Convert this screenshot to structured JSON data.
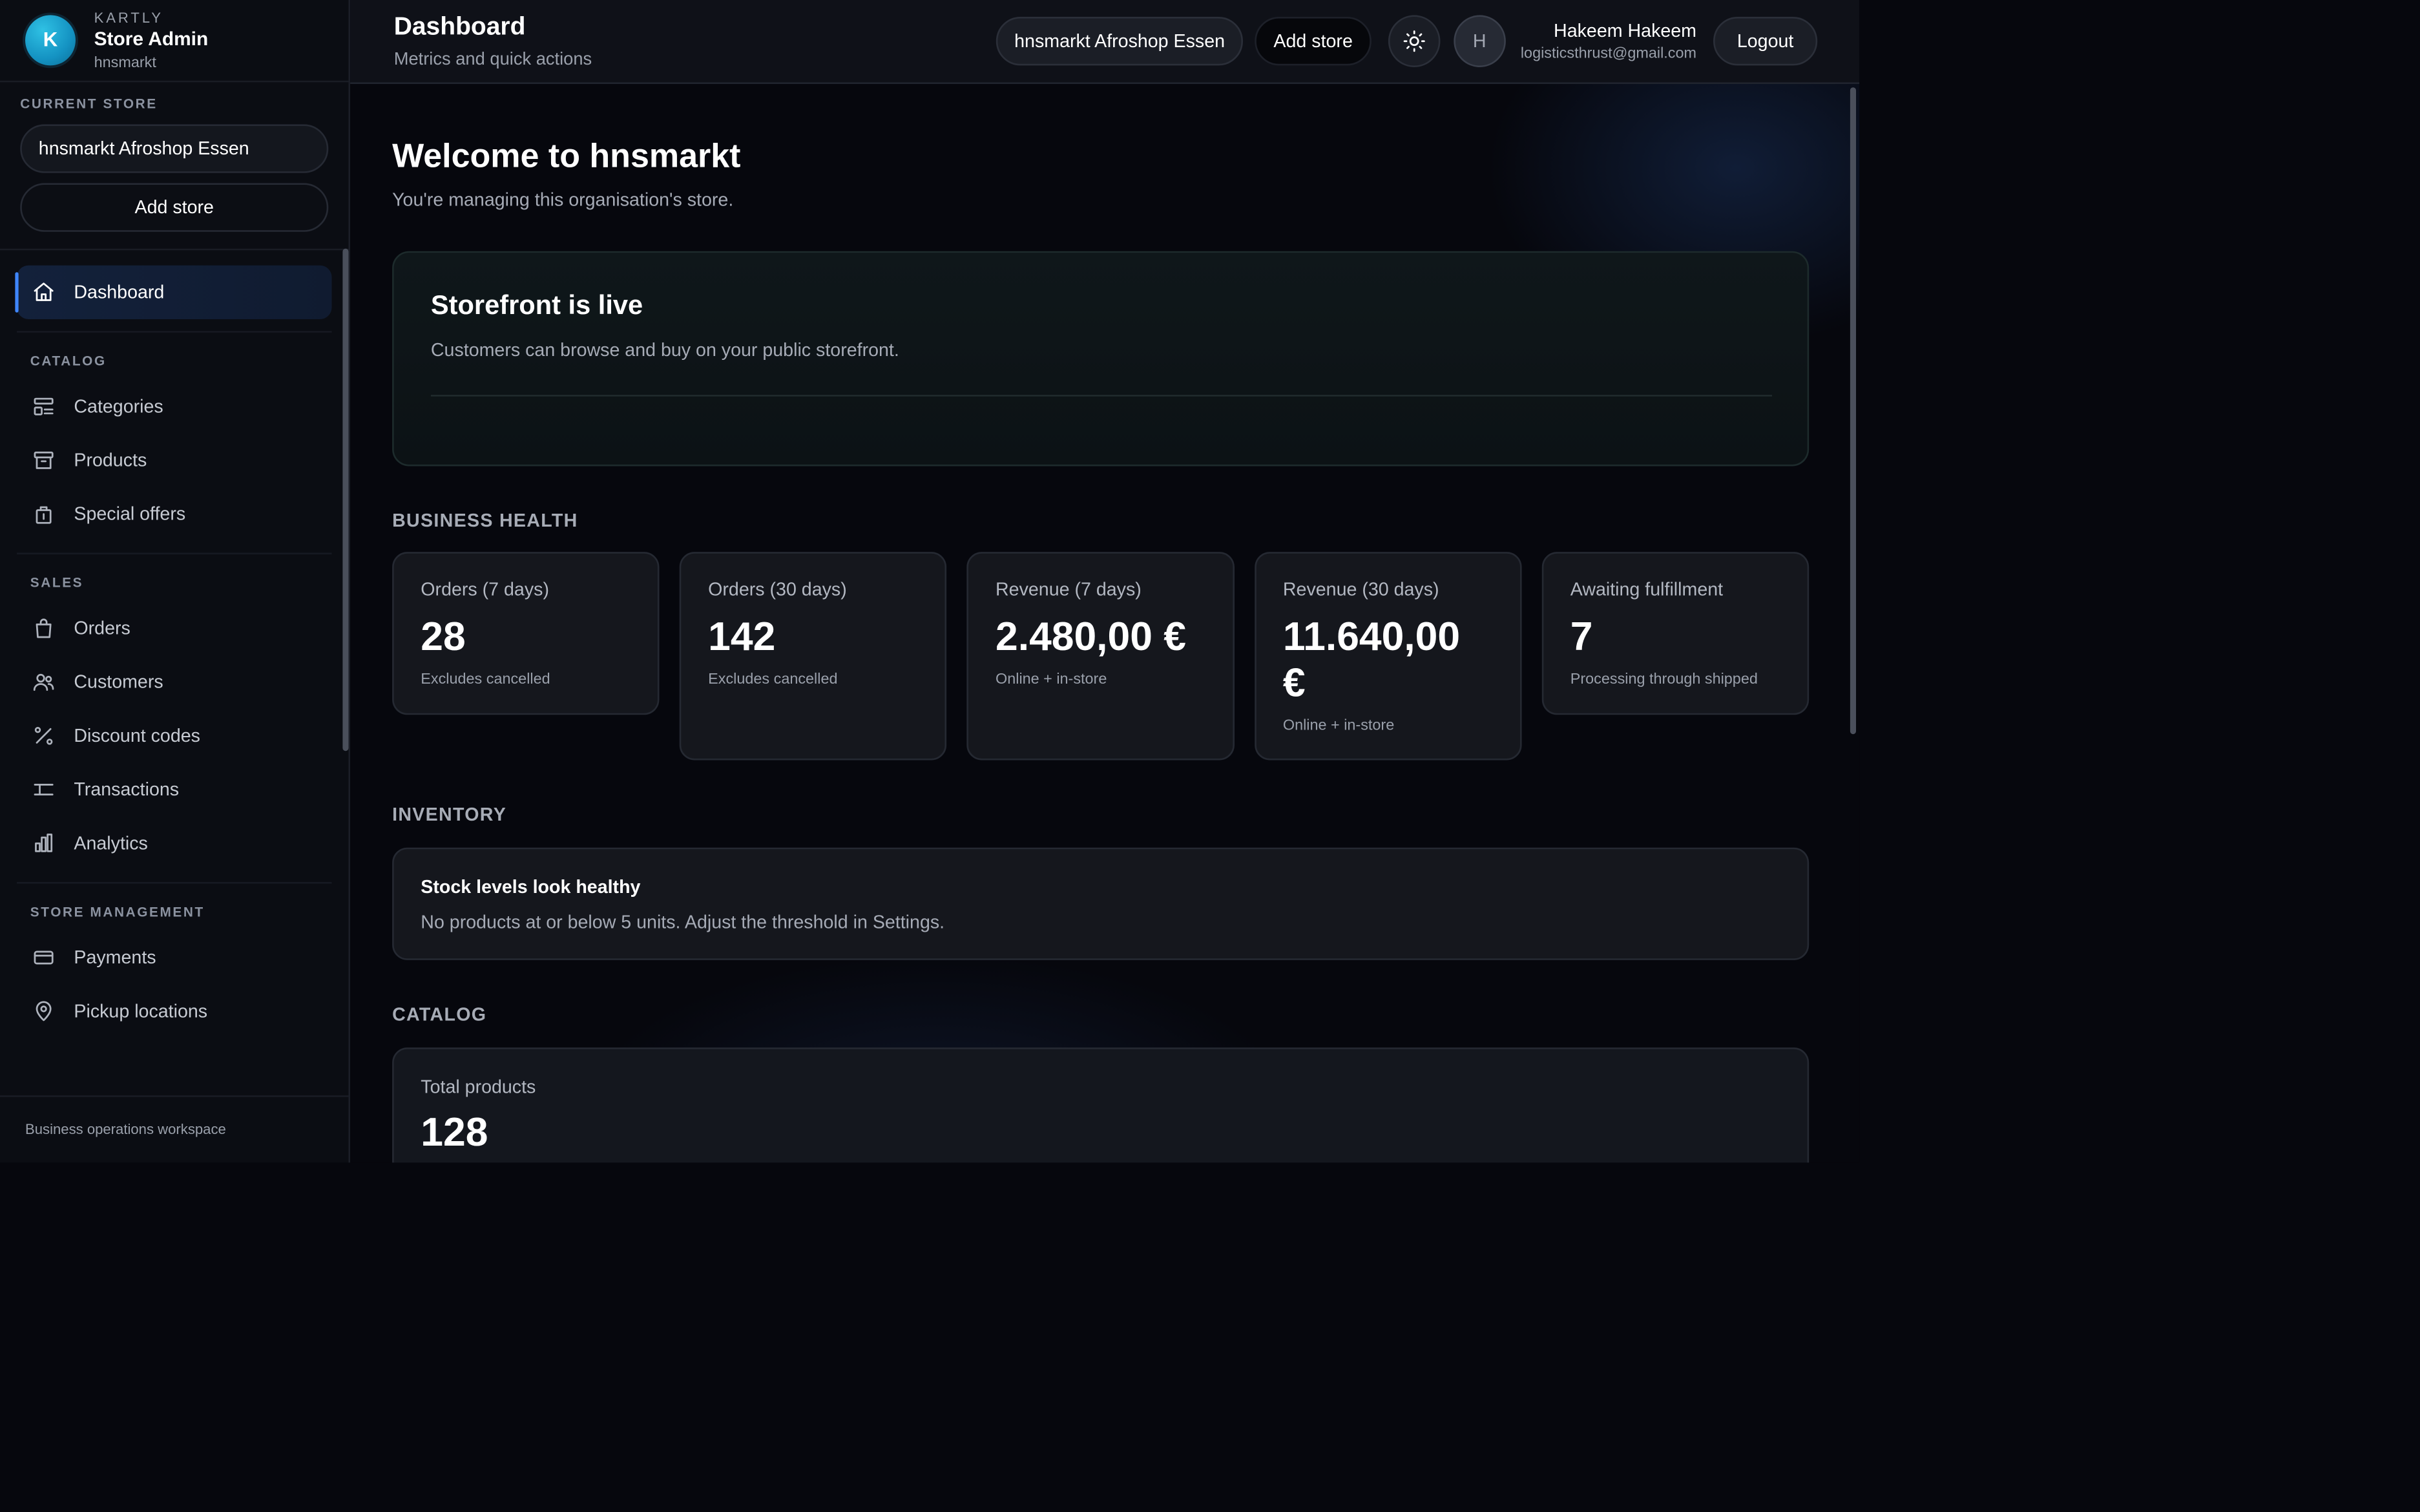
{
  "brand": {
    "logo_letter": "K",
    "kicker": "KARTLY",
    "title": "Store Admin",
    "subtitle": "hnsmarkt"
  },
  "sidebar": {
    "current_store_label": "CURRENT STORE",
    "current_store": "hnsmarkt Afroshop Essen",
    "add_store_label": "Add store",
    "dashboard_label": "Dashboard",
    "groups": [
      {
        "label": "CATALOG",
        "items": [
          {
            "label": "Categories",
            "icon": "categories-icon"
          },
          {
            "label": "Products",
            "icon": "box-icon"
          },
          {
            "label": "Special offers",
            "icon": "gift-icon"
          }
        ]
      },
      {
        "label": "SALES",
        "items": [
          {
            "label": "Orders",
            "icon": "shopping-bag-icon"
          },
          {
            "label": "Customers",
            "icon": "users-icon"
          },
          {
            "label": "Discount codes",
            "icon": "percent-icon"
          },
          {
            "label": "Transactions",
            "icon": "transfer-icon"
          },
          {
            "label": "Analytics",
            "icon": "bar-chart-icon"
          }
        ]
      },
      {
        "label": "STORE MANAGEMENT",
        "items": [
          {
            "label": "Payments",
            "icon": "credit-card-icon"
          },
          {
            "label": "Pickup locations",
            "icon": "map-pin-icon"
          }
        ]
      }
    ],
    "footer": "Business operations workspace"
  },
  "header": {
    "title": "Dashboard",
    "subtitle": "Metrics and quick actions",
    "store_button": "hnsmarkt Afroshop Essen",
    "add_store_button": "Add store",
    "theme_icon": "sun-icon",
    "avatar_letter": "H",
    "user_name": "Hakeem Hakeem",
    "user_email": "logisticsthrust@gmail.com",
    "logout_label": "Logout"
  },
  "welcome": {
    "title": "Welcome to hnsmarkt",
    "subtitle": "You're managing this organisation's store."
  },
  "storefront": {
    "title": "Storefront is live",
    "description": "Customers can browse and buy on your public storefront."
  },
  "business_health": {
    "title": "BUSINESS HEALTH",
    "metrics": [
      {
        "label": "Orders (7 days)",
        "value": "28",
        "note": "Excludes cancelled"
      },
      {
        "label": "Orders (30 days)",
        "value": "142",
        "note": "Excludes cancelled"
      },
      {
        "label": "Revenue (7 days)",
        "value": "2.480,00 €",
        "note": "Online + in-store"
      },
      {
        "label": "Revenue (30 days)",
        "value": "11.640,00 €",
        "note": "Online + in-store"
      },
      {
        "label": "Awaiting fulfillment",
        "value": "7",
        "note": "Processing through shipped"
      }
    ]
  },
  "inventory": {
    "title": "INVENTORY",
    "status_title": "Stock levels look healthy",
    "status_text": "No products at or below 5 units. Adjust the threshold in Settings."
  },
  "catalog": {
    "title": "CATALOG",
    "total_label": "Total products",
    "total_value": "128"
  },
  "colors": {
    "accent": "#3f86ff",
    "brand": "#1492c2",
    "background": "#06070d"
  }
}
